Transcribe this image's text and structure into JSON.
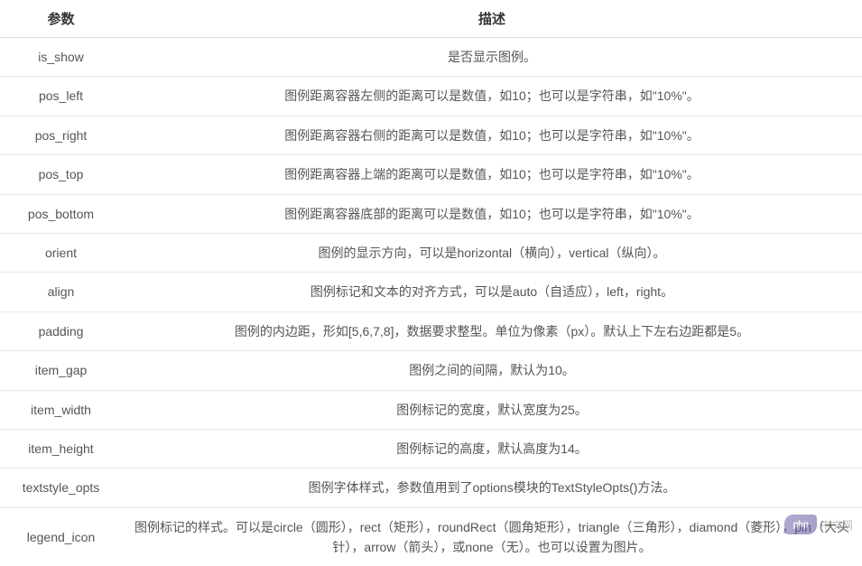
{
  "table": {
    "headers": {
      "param": "参数",
      "desc": "描述"
    },
    "rows": [
      {
        "param": "is_show",
        "desc": "是否显示图例。"
      },
      {
        "param": "pos_left",
        "desc": "图例距离容器左侧的距离可以是数值，如10；也可以是字符串，如\"10%\"。"
      },
      {
        "param": "pos_right",
        "desc": "图例距离容器右侧的距离可以是数值，如10；也可以是字符串，如\"10%\"。"
      },
      {
        "param": "pos_top",
        "desc": "图例距离容器上端的距离可以是数值，如10；也可以是字符串，如\"10%\"。"
      },
      {
        "param": "pos_bottom",
        "desc": "图例距离容器底部的距离可以是数值，如10；也可以是字符串，如\"10%\"。"
      },
      {
        "param": "orient",
        "desc": "图例的显示方向，可以是horizontal（横向），vertical（纵向）。"
      },
      {
        "param": "align",
        "desc": "图例标记和文本的对齐方式，可以是auto（自适应），left，right。"
      },
      {
        "param": "padding",
        "desc": "图例的内边距，形如[5,6,7,8]，数据要求整型。单位为像素（px）。默认上下左右边距都是5。"
      },
      {
        "param": "item_gap",
        "desc": "图例之间的间隔，默认为10。"
      },
      {
        "param": "item_width",
        "desc": "图例标记的宽度，默认宽度为25。"
      },
      {
        "param": "item_height",
        "desc": "图例标记的高度，默认高度为14。"
      },
      {
        "param": "textstyle_opts",
        "desc": "图例字体样式，参数值用到了options模块的TextStyleOpts()方法。"
      },
      {
        "param": "legend_icon",
        "desc": "图例标记的样式。可以是circle（圆形），rect（矩形），roundRect（圆角矩形），triangle（三角形），diamond（菱形），pin（大头针），arrow（箭头），或none（无）。也可以设置为图片。"
      }
    ]
  },
  "watermark": {
    "text": "中文网"
  }
}
